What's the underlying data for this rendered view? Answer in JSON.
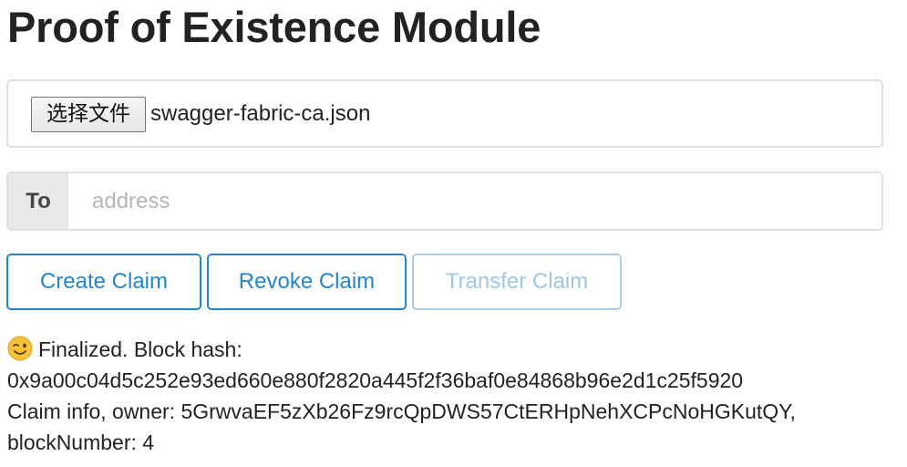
{
  "page": {
    "title": "Proof of Existence Module"
  },
  "file_input": {
    "button_label": "选择文件",
    "file_name": "swagger-fabric-ca.json"
  },
  "to_field": {
    "label": "To",
    "placeholder": "address",
    "value": ""
  },
  "actions": {
    "create_label": "Create Claim",
    "revoke_label": "Revoke Claim",
    "transfer_label": "Transfer Claim",
    "transfer_disabled": true
  },
  "status": {
    "icon": "winking-face-emoji",
    "line1": "Finalized. Block hash:",
    "line2": "0x9a00c04d5c252e93ed660e880f2820a445f2f36baf0e84868b96e2d1c25f5920",
    "line3": "Claim info, owner: 5GrwvaEF5zXb26Fz9rcQpDWS57CtERHpNehXCPcNoHGKutQY,",
    "line4": "blockNumber: 4"
  },
  "colors": {
    "accent": "#2185d0",
    "disabled_accent": "#a9cdea",
    "label_bg": "#e8e8e8",
    "border": "#e0e0e0"
  }
}
